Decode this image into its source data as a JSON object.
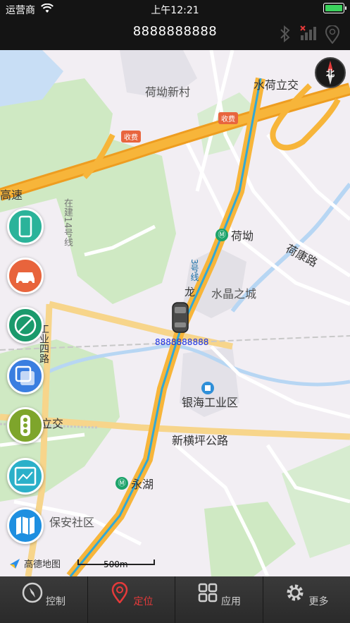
{
  "status_bar": {
    "carrier": "运营商",
    "time": "上午12:21"
  },
  "header": {
    "device_id": "8888888888"
  },
  "map": {
    "labels": {
      "hekao_village": "荷坳新村",
      "shuihe_interchange": "水荷立交",
      "toll_1": "收费",
      "toll_2": "收费",
      "gaosu": "高速",
      "hekang_road": "荷康路",
      "shuijing_city": "水晶之城",
      "yinhai_park": "银海工业区",
      "xinhengping_road": "新横坪公路",
      "yonghu": "永湖",
      "baoan_community": "保安社区",
      "interchange_left": "立交",
      "road_left": "工业四路",
      "line3": "3号线",
      "line14": "在建14号线",
      "long": "龙"
    },
    "metro_stations": [
      "荷坳",
      "永湖"
    ],
    "compass": "北",
    "vehicle_label": "8888888888",
    "scale": "500m",
    "provider": "高德地图"
  },
  "side_buttons": [
    {
      "icon": "phone-icon",
      "color": "#2bb39a"
    },
    {
      "icon": "car-icon",
      "color": "#e8643c"
    },
    {
      "icon": "no-track-icon",
      "color": "#1a9a6c"
    },
    {
      "icon": "layers-icon",
      "color": "#3a7ee0"
    },
    {
      "icon": "traffic-light-icon",
      "color": "#7ea52b"
    },
    {
      "icon": "playback-icon",
      "color": "#2bb0c9"
    },
    {
      "icon": "map-icon",
      "color": "#1e8fe0"
    }
  ],
  "nav": {
    "items": [
      {
        "label": "控制",
        "icon": "compass-icon"
      },
      {
        "label": "定位",
        "icon": "location-pin-icon"
      },
      {
        "label": "应用",
        "icon": "grid-icon"
      },
      {
        "label": "更多",
        "icon": "gear-icon"
      }
    ],
    "active_index": 1
  },
  "colors": {
    "accent": "#e53a3a",
    "highway": "#f5a623",
    "metro": "#1ca36a",
    "vehicle_label": "#1a2fe0"
  }
}
